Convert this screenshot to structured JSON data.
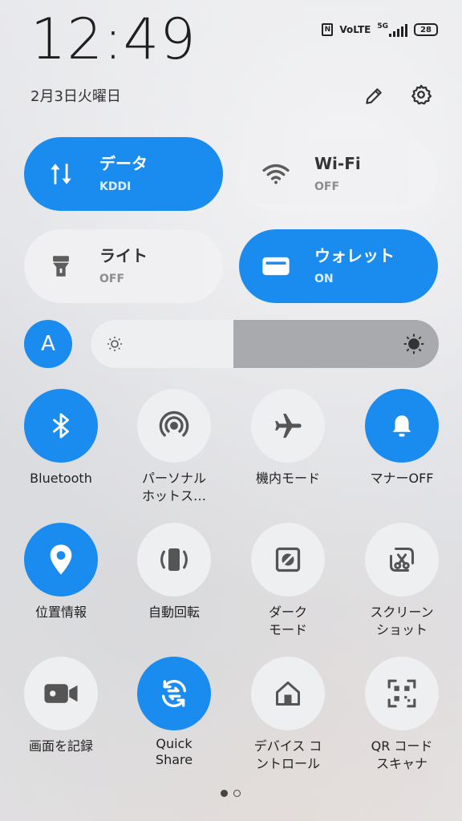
{
  "status_bar": {
    "time": "12:49",
    "date": "2月3日火曜日",
    "nfc": "N",
    "volte": "VoLTE",
    "network": "5G",
    "battery": "28"
  },
  "big_tiles": [
    {
      "title": "データ",
      "subtitle": "KDDI",
      "state": "on",
      "icon": "data-transfer-icon"
    },
    {
      "title": "Wi-Fi",
      "subtitle": "OFF",
      "state": "off",
      "icon": "wifi-icon"
    },
    {
      "title": "ライト",
      "subtitle": "OFF",
      "state": "off",
      "icon": "flashlight-icon"
    },
    {
      "title": "ウォレット",
      "subtitle": "ON",
      "state": "on",
      "icon": "wallet-icon"
    }
  ],
  "brightness": {
    "auto_label": "A",
    "level": 0.41
  },
  "toggles": [
    {
      "label": "Bluetooth",
      "state": "on",
      "icon": "bluetooth-icon"
    },
    {
      "label": "パーソナル\nホットス…",
      "state": "off",
      "icon": "hotspot-icon"
    },
    {
      "label": "機内モード",
      "state": "off",
      "icon": "airplane-icon"
    },
    {
      "label": "マナーOFF",
      "state": "on",
      "icon": "bell-icon"
    },
    {
      "label": "位置情報",
      "state": "on",
      "icon": "location-icon"
    },
    {
      "label": "自動回転",
      "state": "off",
      "icon": "auto-rotate-icon"
    },
    {
      "label": "ダーク\nモード",
      "state": "off",
      "icon": "dark-mode-icon"
    },
    {
      "label": "スクリーン\nショット",
      "state": "off",
      "icon": "screenshot-icon"
    },
    {
      "label": "画面を記録",
      "state": "off",
      "icon": "screen-record-icon"
    },
    {
      "label": "Quick\nShare",
      "state": "on",
      "icon": "quick-share-icon"
    },
    {
      "label": "デバイス コ\nントロール",
      "state": "off",
      "icon": "device-control-icon"
    },
    {
      "label": "QR コード\nスキャナ",
      "state": "off",
      "icon": "qr-scanner-icon"
    }
  ],
  "colors": {
    "accent": "#1a8cf0",
    "tile_off": "#f1f1f3",
    "icon_dark": "#555555"
  },
  "pager": {
    "pages": 2,
    "current": 1
  }
}
